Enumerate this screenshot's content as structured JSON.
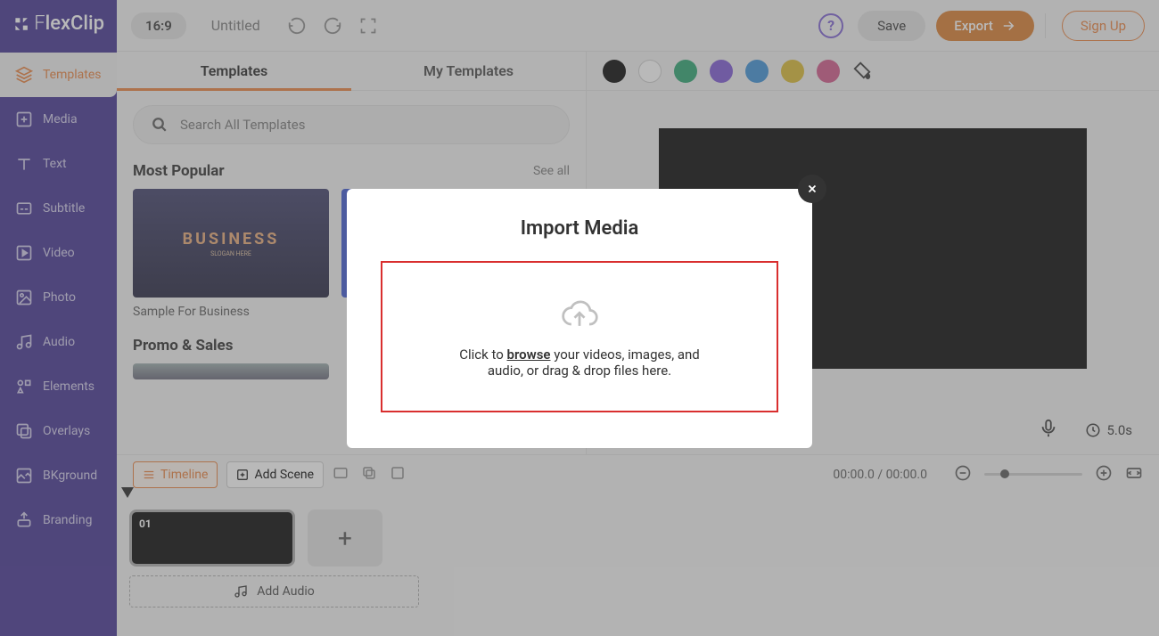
{
  "logo": "lexClip",
  "sidebar": {
    "items": [
      {
        "label": "Templates"
      },
      {
        "label": "Media"
      },
      {
        "label": "Text"
      },
      {
        "label": "Subtitle"
      },
      {
        "label": "Video"
      },
      {
        "label": "Photo"
      },
      {
        "label": "Audio"
      },
      {
        "label": "Elements"
      },
      {
        "label": "Overlays"
      },
      {
        "label": "BKground"
      },
      {
        "label": "Branding"
      }
    ]
  },
  "topbar": {
    "ratio": "16:9",
    "title": "Untitled",
    "save": "Save",
    "export": "Export",
    "signup": "Sign Up"
  },
  "panel": {
    "tabs": {
      "templates": "Templates",
      "my": "My Templates"
    },
    "search_placeholder": "Search All Templates",
    "sections": [
      {
        "title": "Most Popular",
        "see": "See all",
        "card": "Sample For Business",
        "thumb_big": "BUSINESS",
        "thumb_small": "SLOGAN HERE"
      },
      {
        "title": "Promo & Sales"
      }
    ]
  },
  "canvas": {
    "swatches": [
      "#000000",
      "#ffffff",
      "#27a36e",
      "#7a55d4",
      "#3a8fd6",
      "#d9b92e",
      "#d05588"
    ],
    "duration": "5.0s"
  },
  "timeline": {
    "timeline_btn": "Timeline",
    "addscene_btn": "Add Scene",
    "time": "00:00.0 / 00:00.0",
    "clip_num": "01",
    "add_audio": "Add Audio"
  },
  "modal": {
    "title": "Import Media",
    "text_pre": "Click to ",
    "browse": "browse",
    "text_mid": " your videos, images, and",
    "text_line2": "audio, or drag & drop files here."
  }
}
